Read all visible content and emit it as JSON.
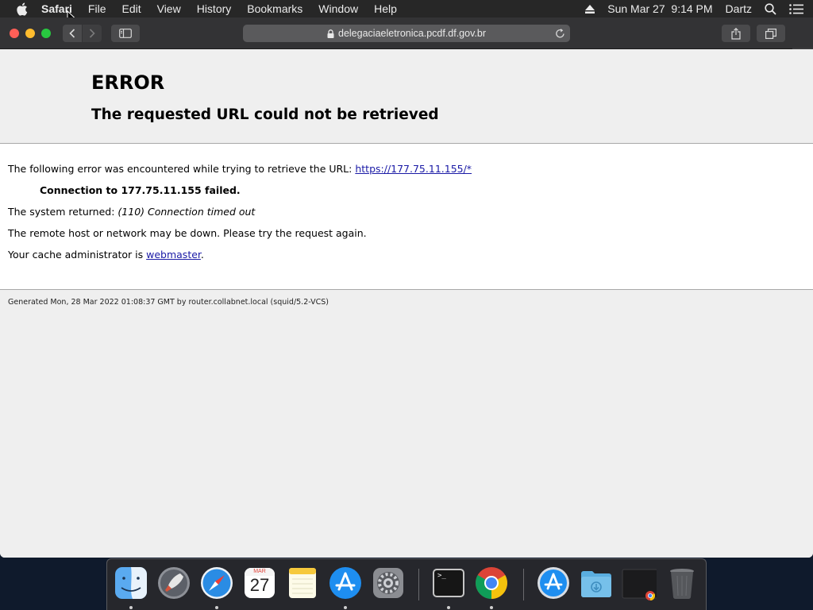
{
  "menubar": {
    "app_name": "Safari",
    "menus": [
      "File",
      "Edit",
      "View",
      "History",
      "Bookmarks",
      "Window",
      "Help"
    ],
    "clock": "Sun Mar 27  9:14 PM",
    "user": "Dartz"
  },
  "browser": {
    "url": "delegaciaeletronica.pcdf.df.gov.br"
  },
  "page": {
    "title": "ERROR",
    "subtitle": "The requested URL could not be retrieved",
    "line1_prefix": "The following error was encountered while trying to retrieve the URL: ",
    "line1_link": "https://177.75.11.155/*",
    "line2": "Connection to 177.75.11.155 failed.",
    "line3_prefix": "The system returned: ",
    "line3_italic": "(110) Connection timed out",
    "line4": "The remote host or network may be down. Please try the request again.",
    "line5_prefix": "Your cache administrator is ",
    "line5_link": "webmaster",
    "line5_suffix": ".",
    "footer": "Generated Mon, 28 Mar 2022 01:08:37 GMT by router.collabnet.local (squid/5.2-VCS)"
  },
  "dock": {
    "calendar_month": "MAR",
    "calendar_day": "27",
    "terminal_prompt": ">_",
    "apps": [
      "finder-icon",
      "launchpad-icon",
      "safari-icon",
      "calendar-icon",
      "notes-icon",
      "app-store-icon",
      "system-preferences-icon",
      "terminal-icon",
      "chrome-icon",
      "applications-folder-icon",
      "downloads-folder-icon",
      "chrome-window-icon",
      "trash-icon"
    ]
  },
  "colors": {
    "link": "#1a1aa6",
    "close": "#fe5f57",
    "minimize": "#febc2e",
    "maximize": "#28c840"
  }
}
